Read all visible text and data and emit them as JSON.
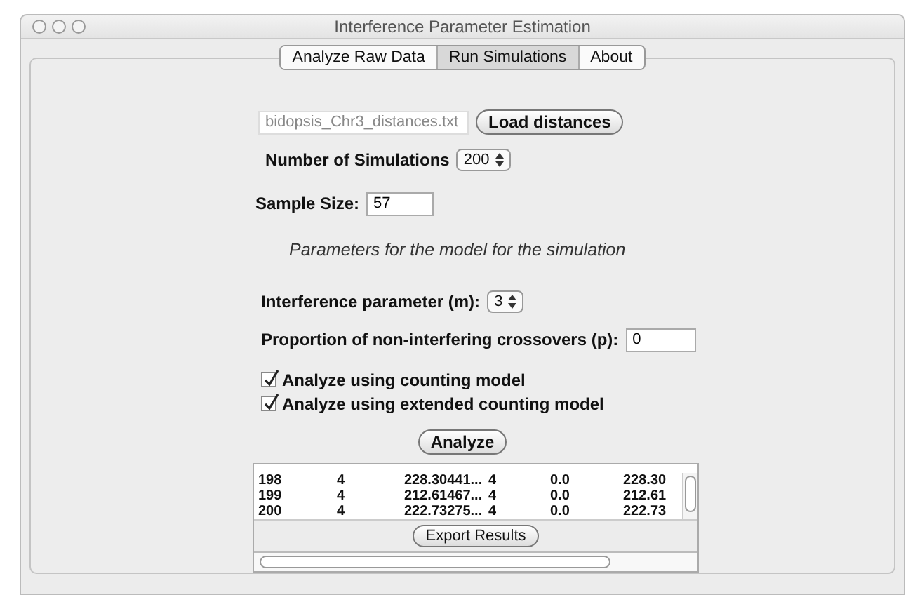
{
  "window": {
    "title": "Interference Parameter Estimation"
  },
  "tabs": [
    {
      "label": "Analyze Raw Data",
      "selected": false
    },
    {
      "label": "Run Simulations",
      "selected": true
    },
    {
      "label": "About",
      "selected": false
    }
  ],
  "file_field": {
    "value": "bidopsis_Chr3_distances.txt"
  },
  "load_button": "Load distances",
  "simulations": {
    "label": "Number of Simulations",
    "value": "200"
  },
  "sample_size": {
    "label": "Sample Size:",
    "value": "57"
  },
  "section_heading": "Parameters for the model for the simulation",
  "interference": {
    "label": "Interference parameter (m):",
    "value": "3"
  },
  "proportion": {
    "label": "Proportion of non-interfering crossovers (p):",
    "value": "0"
  },
  "options": [
    {
      "label": "Analyze using counting model",
      "checked": true
    },
    {
      "label": "Analyze using extended counting model",
      "checked": true
    }
  ],
  "analyze_button": "Analyze",
  "results": {
    "rows": [
      [
        "198",
        "4",
        "228.30441...",
        "4",
        "0.0",
        "228.30"
      ],
      [
        "199",
        "4",
        "212.61467...",
        "4",
        "0.0",
        "212.61"
      ],
      [
        "200",
        "4",
        "222.73275...",
        "4",
        "0.0",
        "222.73"
      ]
    ]
  },
  "export_button": "Export Results"
}
